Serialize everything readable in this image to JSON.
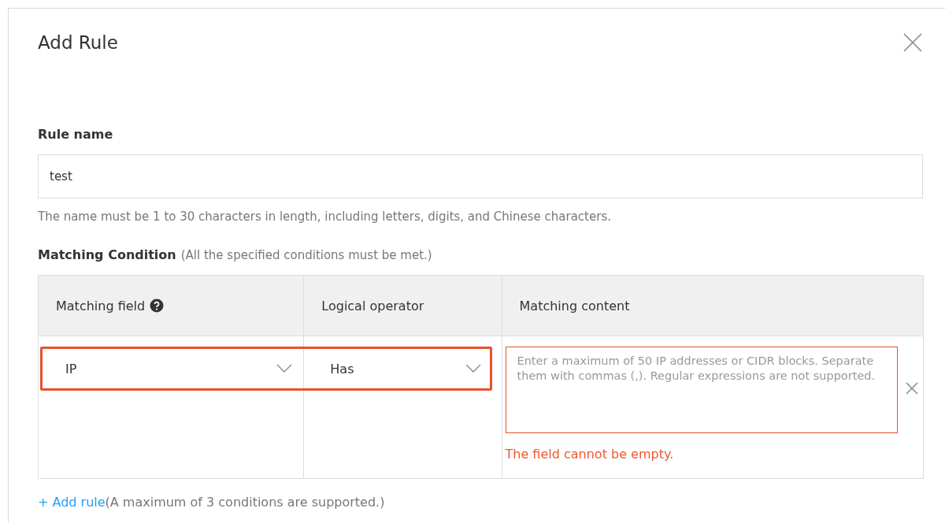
{
  "dialog": {
    "title": "Add Rule"
  },
  "rule_name": {
    "label": "Rule name",
    "value": "test",
    "hint": "The name must be 1 to 30 characters in length, including letters, digits, and Chinese characters."
  },
  "matching_condition": {
    "label": "Matching Condition",
    "note": "(All the specified conditions must be met.)",
    "columns": [
      {
        "label": "Matching field",
        "help": true
      },
      {
        "label": "Logical operator",
        "help": false
      },
      {
        "label": "Matching content",
        "help": false
      }
    ],
    "rows": [
      {
        "field": "IP",
        "operator": "Has",
        "content_placeholder": "Enter a maximum of 50 IP addresses or CIDR blocks. Separate them with commas (,). Regular expressions are not supported.",
        "error": "The field cannot be empty.",
        "highlighted": true
      }
    ]
  },
  "add_rule": {
    "link": "+ Add rule",
    "note": "(A maximum of 3 conditions are supported.)"
  }
}
